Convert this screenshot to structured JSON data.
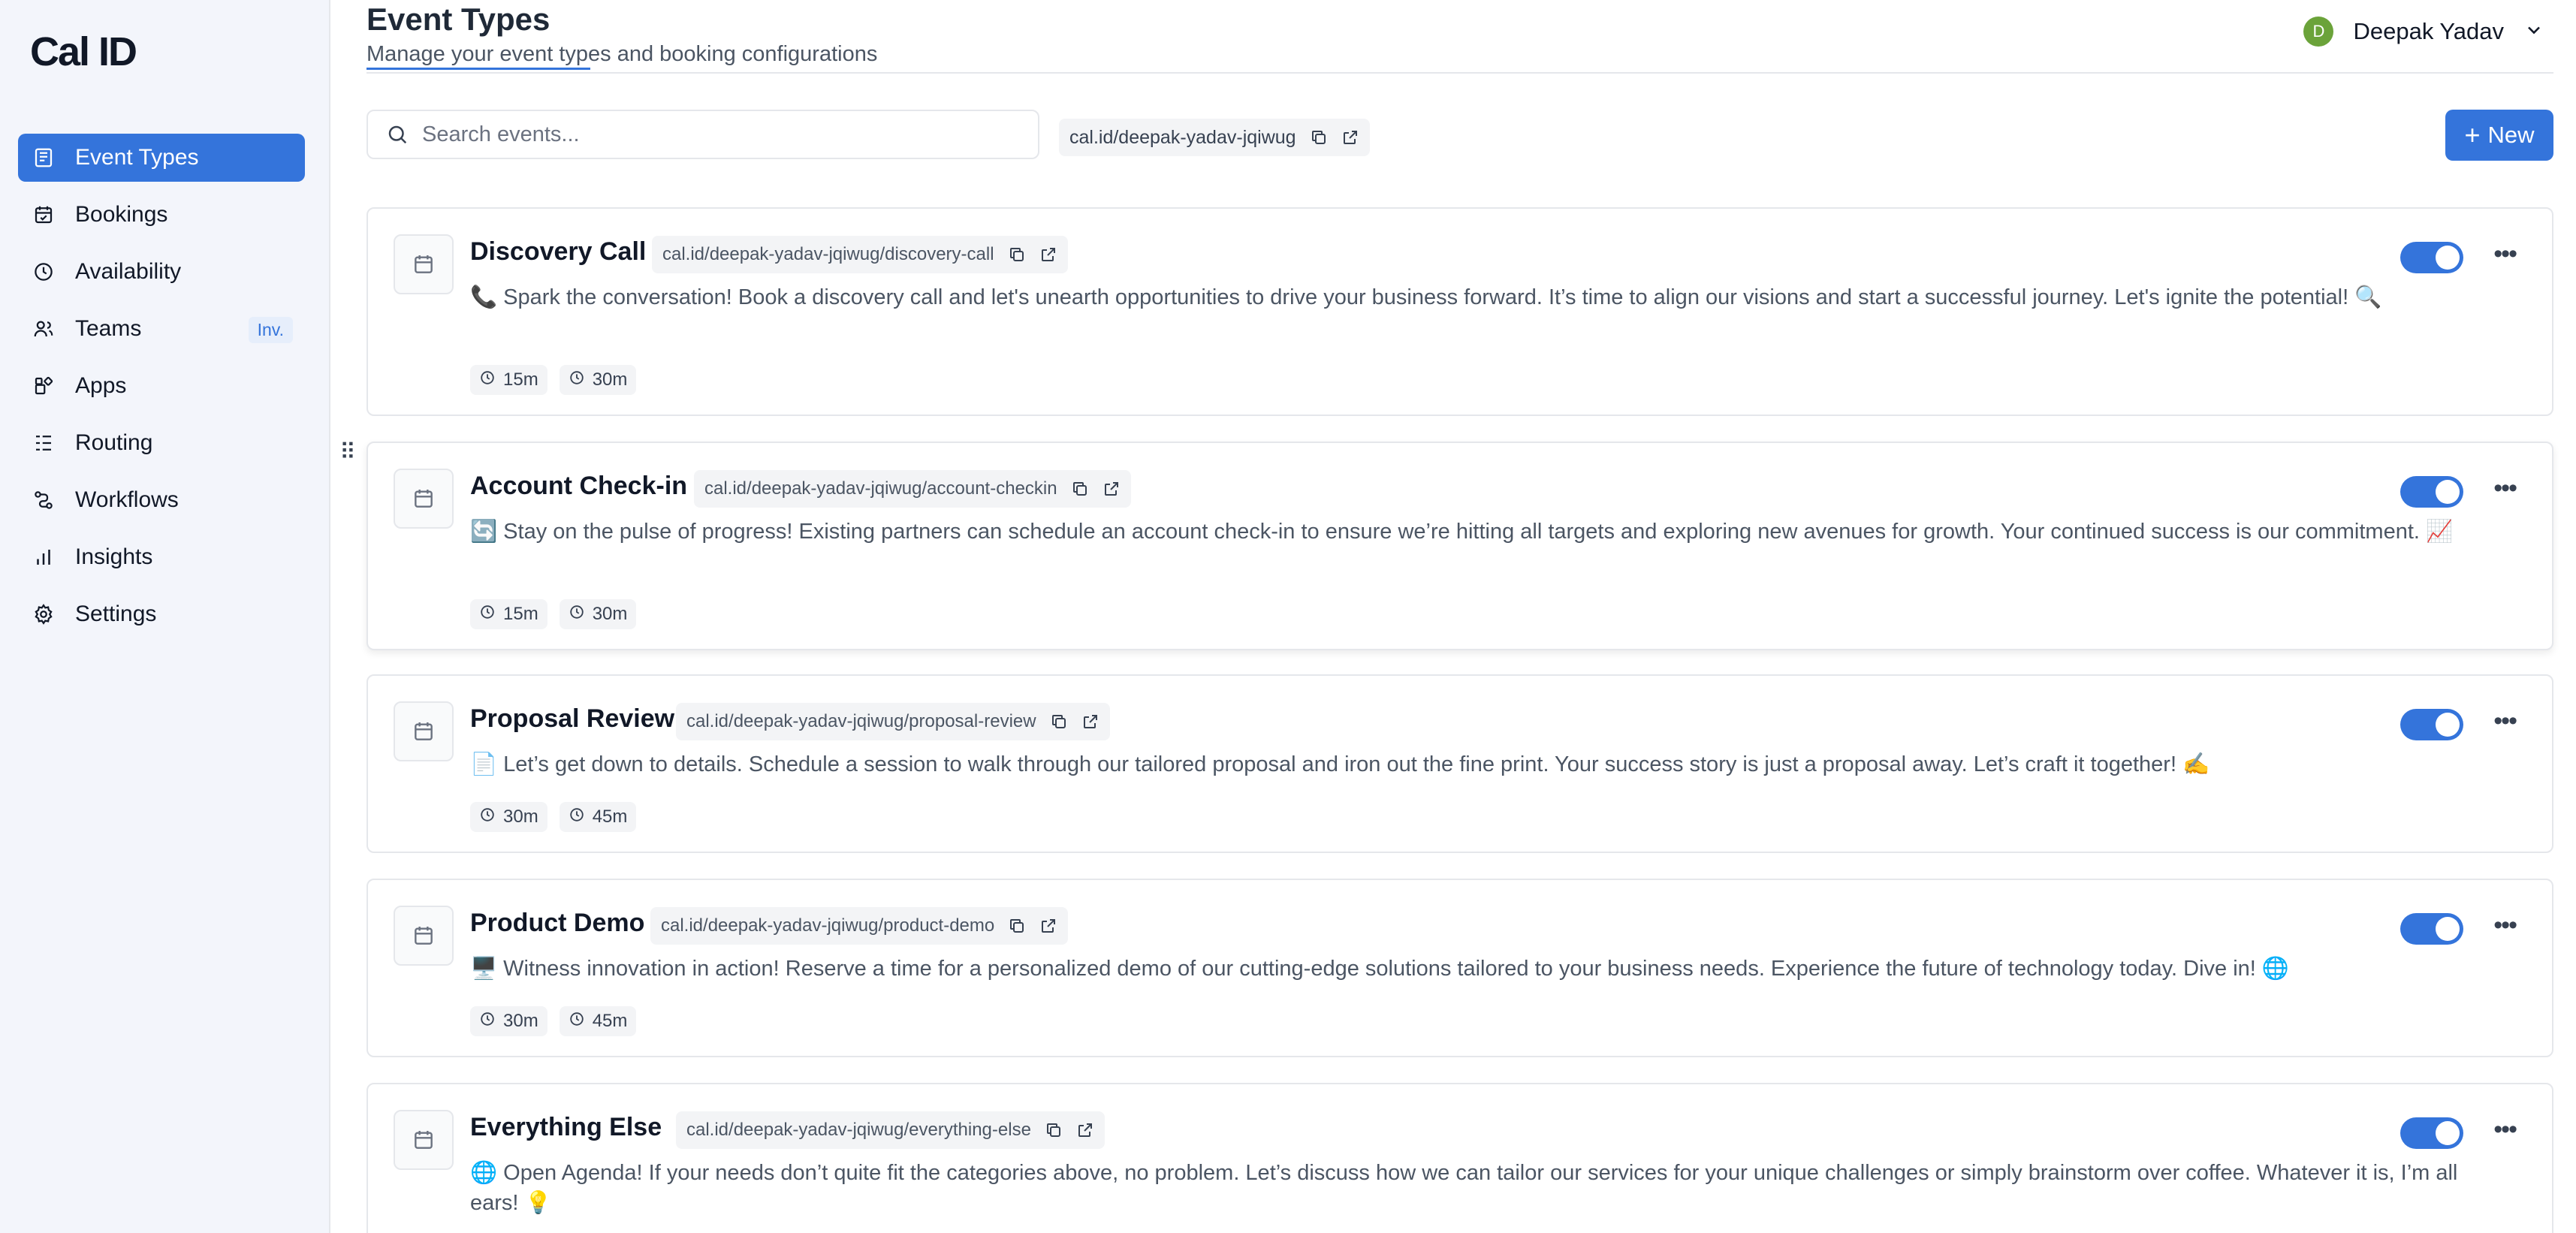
{
  "app": {
    "logo": "Cal ID"
  },
  "sidebar": {
    "items": [
      {
        "label": "Event Types",
        "icon": "event-types-icon",
        "active": true
      },
      {
        "label": "Bookings",
        "icon": "calendar-check-icon"
      },
      {
        "label": "Availability",
        "icon": "clock-icon"
      },
      {
        "label": "Teams",
        "icon": "users-icon",
        "badge": "Inv."
      },
      {
        "label": "Apps",
        "icon": "grid-icon"
      },
      {
        "label": "Routing",
        "icon": "list-icon"
      },
      {
        "label": "Workflows",
        "icon": "workflow-icon"
      },
      {
        "label": "Insights",
        "icon": "bar-chart-icon"
      },
      {
        "label": "Settings",
        "icon": "gear-icon"
      }
    ]
  },
  "header": {
    "title": "Event Types",
    "subtitle": "Manage your event types and booking configurations",
    "user": {
      "name": "Deepak Yadav",
      "initial": "D",
      "avatar_color": "#6ba33a"
    }
  },
  "toolbar": {
    "search_placeholder": "Search events...",
    "profile_link": "cal.id/deepak-yadav-jqiwug",
    "new_label": "New"
  },
  "colors": {
    "accent": "#3474db",
    "sidebar_bg": "#f3f5fb",
    "border": "#e5e7eb"
  },
  "events": [
    {
      "title": "Discovery Call",
      "link": "cal.id/deepak-yadav-jqiwug/discovery-call",
      "description": "📞 Spark the conversation! Book a discovery call and let's unearth opportunities to drive your business forward. It’s time to align our visions and start a successful journey. Let's ignite the potential! 🔍",
      "durations": [
        "15m",
        "30m"
      ],
      "enabled": true
    },
    {
      "title": "Account Check-in",
      "link": "cal.id/deepak-yadav-jqiwug/account-checkin",
      "description": "🔄 Stay on the pulse of progress! Existing partners can schedule an account check-in to ensure we’re hitting all targets and exploring new avenues for growth. Your continued success is our commitment. 📈",
      "durations": [
        "15m",
        "30m"
      ],
      "enabled": true
    },
    {
      "title": "Proposal Review",
      "link": "cal.id/deepak-yadav-jqiwug/proposal-review",
      "description": "📄 Let’s get down to details. Schedule a session to walk through our tailored proposal and iron out the fine print. Your success story is just a proposal away. Let’s craft it together! ✍️",
      "durations": [
        "30m",
        "45m"
      ],
      "enabled": true
    },
    {
      "title": "Product Demo",
      "link": "cal.id/deepak-yadav-jqiwug/product-demo",
      "description": "🖥️ Witness innovation in action! Reserve a time for a personalized demo of our cutting-edge solutions tailored to your business needs. Experience the future of technology today. Dive in! 🌐",
      "durations": [
        "30m",
        "45m"
      ],
      "enabled": true
    },
    {
      "title": "Everything Else",
      "link": "cal.id/deepak-yadav-jqiwug/everything-else",
      "description": "🌐 Open Agenda! If your needs don’t quite fit the categories above, no problem. Let’s discuss how we can tailor our services for your unique challenges or simply brainstorm over coffee. Whatever it is, I’m all ears! 💡",
      "durations": [],
      "enabled": true
    }
  ]
}
